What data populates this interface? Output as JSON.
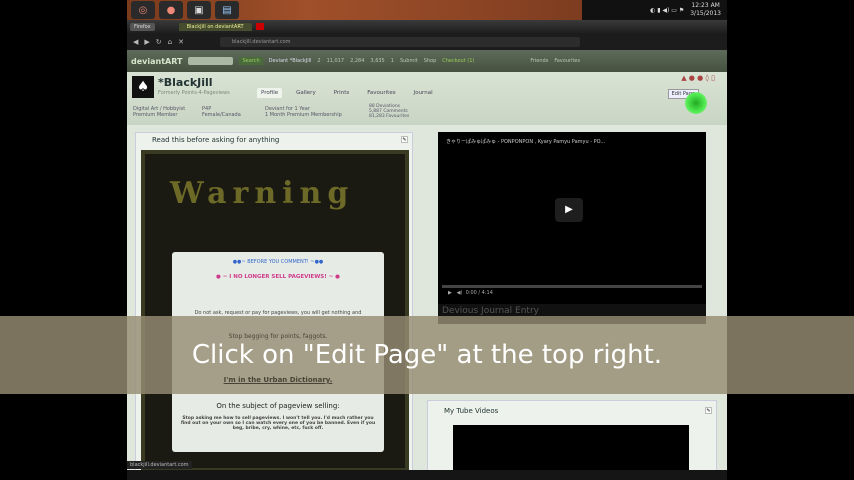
{
  "os": {
    "time": "12:23 AM",
    "date": "3/15/2013"
  },
  "browser": {
    "menu": "Firefox",
    "tab_title": "BlackJill on deviantART",
    "url": "blackjill.deviantart.com",
    "status_url": "blackjill.deviantart.com"
  },
  "da_header": {
    "logo": "deviantART",
    "search_button": "Search",
    "user": "Deviant *BlackJill",
    "counts": [
      "2",
      "11,017",
      "2,284",
      "3,635",
      "1"
    ],
    "submit": "Submit",
    "shop": "Shop",
    "checkout": "Checkout (1)",
    "friends": "Friends",
    "favourites": "Favourites"
  },
  "profile": {
    "username": "*BlackJill",
    "tagline": "Formerly Points-4-Pageviews",
    "tabs": [
      "Profile",
      "Gallery",
      "Prints",
      "Favourites",
      "Journal"
    ],
    "meta1": [
      "Digital Art / Hobbyist",
      "Premium Member"
    ],
    "meta2": [
      "P4P",
      "Female/Canada"
    ],
    "meta3": [
      "Deviant for 1 Year",
      "1 Month Premium Membership"
    ],
    "meta4": [
      "88 Deviations",
      "5,887 Comments",
      "81,283 Favourites"
    ],
    "edit_page": "Edit Page"
  },
  "left_panel": {
    "title": "Read this before asking for anything",
    "banner": "Warning",
    "before": "●●~ BEFORE YOU COMMENT! ~●●",
    "no_longer": "● ~ I NO LONGER SELL PAGEVIEWS! ~ ●",
    "dont_ask": "Do not ask, request or pay for pageviews, you will get nothing and",
    "stop_begging": "Stop begging for points, faggots.",
    "urban": "I'm in the Urban Dictionary.",
    "subject": "On the subject of pageview selling:",
    "body": "Stop asking me how to sell pageviews. I won't tell you. I'd much rather you find out on your own so I can watch every one of you be banned. Even if you beg, bribe, cry, whine, etc, fuck off."
  },
  "video": {
    "title": "きゃりーぱみゅぱみゅ - PONPONPON , Kyary Pamyu Pamyu - PO...",
    "time": "0:00 / 4:14",
    "progress": 0
  },
  "journal": {
    "title": "Devious Journal Entry"
  },
  "tube": {
    "title": "My Tube Videos"
  },
  "caption": "Click on \"Edit Page\" at the top right."
}
